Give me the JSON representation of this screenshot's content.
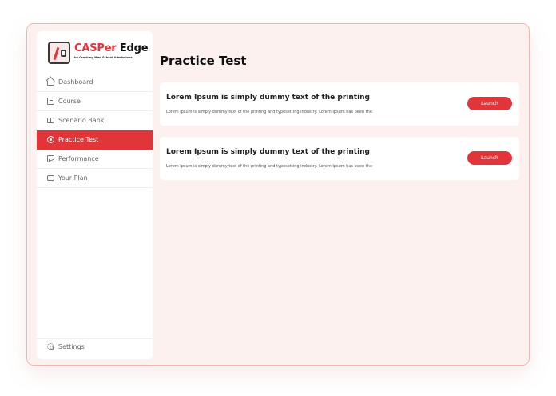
{
  "brand": {
    "name_accent": "CASPer",
    "name_rest": " Edge",
    "tagline": "by Cracking Med School Admissions"
  },
  "sidebar": {
    "items": [
      {
        "label": "Dashboard",
        "icon": "home-icon",
        "active": false
      },
      {
        "label": "Course",
        "icon": "book-icon",
        "active": false
      },
      {
        "label": "Scenario Bank",
        "icon": "open-book-icon",
        "active": false
      },
      {
        "label": "Practice Test",
        "icon": "target-icon",
        "active": true
      },
      {
        "label": "Performance",
        "icon": "chart-icon",
        "active": false
      },
      {
        "label": "Your Plan",
        "icon": "plan-icon",
        "active": false
      }
    ],
    "settings_label": "Settings"
  },
  "main": {
    "title": "Practice Test",
    "tests": [
      {
        "title": "Lorem Ipsum is simply dummy text of the printing",
        "description": "Lorem Ipsum is simply dummy text of the printing and typesetting industry. Lorem Ipsum has been the",
        "button_label": "Launch"
      },
      {
        "title": "Lorem Ipsum is simply dummy text of the printing",
        "description": "Lorem Ipsum is simply dummy text of the printing and typesetting industry. Lorem Ipsum has been the",
        "button_label": "Launch"
      }
    ]
  },
  "colors": {
    "accent": "#e2353a",
    "background": "#fdf1f0",
    "border": "#f2b6b1"
  }
}
